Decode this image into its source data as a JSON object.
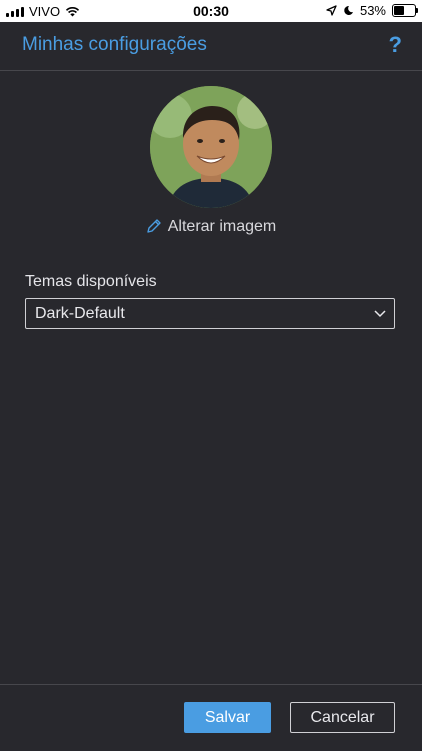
{
  "status_bar": {
    "carrier": "VIVO",
    "time": "00:30",
    "battery_percent": "53%",
    "battery_level": 0.53,
    "icons": [
      "signal-icon",
      "wifi-icon",
      "location-icon",
      "moon-icon",
      "battery-icon"
    ]
  },
  "header": {
    "title": "Minhas configurações",
    "help_label": "?"
  },
  "profile": {
    "avatar_icon": "avatar",
    "change_image_label": "Alterar imagem"
  },
  "themes": {
    "label": "Temas disponíveis",
    "selected": "Dark-Default"
  },
  "footer": {
    "save_label": "Salvar",
    "cancel_label": "Cancelar"
  },
  "colors": {
    "accent": "#4a9de2",
    "background": "#28282d"
  }
}
